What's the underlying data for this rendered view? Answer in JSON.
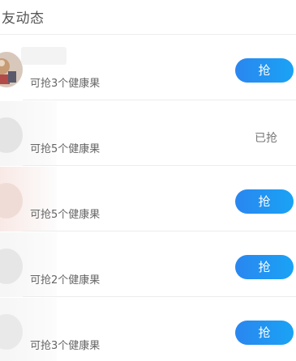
{
  "header": {
    "title": "友动态"
  },
  "rows": [
    {
      "subtitle": "可抢3个健康果",
      "action": "抢",
      "state": "available"
    },
    {
      "subtitle": "可抢5个健康果",
      "action": "已抢",
      "state": "grabbed"
    },
    {
      "subtitle": "可抢5个健康果",
      "action": "抢",
      "state": "available"
    },
    {
      "subtitle": "可抢2个健康果",
      "action": "抢",
      "state": "available"
    },
    {
      "subtitle": "可抢3个健康果",
      "action": "抢",
      "state": "available"
    }
  ],
  "colors": {
    "accent": "#2196F3",
    "text_secondary": "#666666",
    "divider": "#ececec"
  }
}
